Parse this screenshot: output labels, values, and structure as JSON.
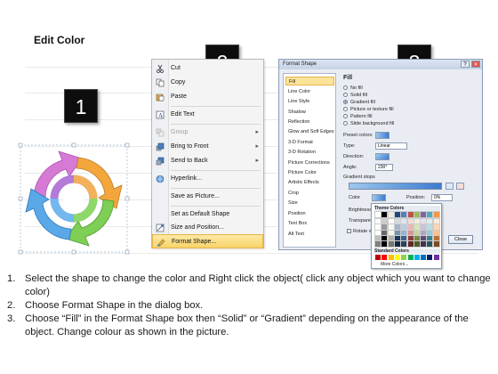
{
  "page": {
    "title": "Edit Color"
  },
  "badges": [
    "1",
    "2",
    "3"
  ],
  "context_menu": {
    "items": [
      {
        "label": "Cut",
        "icon": "scissors-icon"
      },
      {
        "label": "Copy",
        "icon": "copy-icon"
      },
      {
        "label": "Paste",
        "icon": "paste-icon"
      },
      {
        "label": "Edit Text",
        "icon": "edit-text-icon"
      },
      {
        "label": "Group",
        "icon": "group-icon",
        "disabled": true,
        "submenu": true
      },
      {
        "label": "Bring to Front",
        "icon": "bring-front-icon",
        "submenu": true
      },
      {
        "label": "Send to Back",
        "icon": "send-back-icon",
        "submenu": true
      },
      {
        "label": "Hyperlink...",
        "icon": "hyperlink-icon"
      },
      {
        "label": "Save as Picture...",
        "icon": "none"
      },
      {
        "label": "Set as Default Shape",
        "icon": "none"
      },
      {
        "label": "Size and Position...",
        "icon": "size-position-icon"
      },
      {
        "label": "Format Shape...",
        "icon": "format-shape-icon",
        "highlighted": true
      }
    ]
  },
  "dialog": {
    "title": "Format Shape",
    "nav": [
      "Fill",
      "Line Color",
      "Line Style",
      "Shadow",
      "Reflection",
      "Glow and Soft Edges",
      "3-D Format",
      "3-D Rotation",
      "Picture Corrections",
      "Picture Color",
      "Artistic Effects",
      "Crop",
      "Size",
      "Position",
      "Text Box",
      "Alt Text"
    ],
    "heading": "Fill",
    "fill_options": [
      "No fill",
      "Solid fill",
      "Gradient fill",
      "Picture or texture fill",
      "Pattern fill",
      "Slide background fill"
    ],
    "selected_fill": "Gradient fill",
    "preset_colors_label": "Preset colors:",
    "type_label": "Type:",
    "type_value": "Linear",
    "direction_label": "Direction:",
    "angle_label": "Angle:",
    "angle_value": "230°",
    "gradient_stops_label": "Gradient stops",
    "color_label": "Color",
    "position_label": "Position:",
    "position_value": "0%",
    "brightness_label": "Brightness",
    "transparency_label": "Transparen",
    "rotate_label": "Rotate wi",
    "theme_colors_label": "Theme Colors",
    "standard_colors_label": "Standard Colors",
    "more_colors_label": "More Colors...",
    "close_label": "Close",
    "theme_palette": [
      "#ffffff",
      "#000000",
      "#eeece1",
      "#1f497d",
      "#4f81bd",
      "#c0504d",
      "#9bbb59",
      "#8064a2",
      "#4bacc6",
      "#f79646"
    ],
    "standard_palette": [
      "#c00000",
      "#ff0000",
      "#ffc000",
      "#ffff00",
      "#92d050",
      "#00b050",
      "#00b0f0",
      "#0070c0",
      "#002060",
      "#7030a0"
    ]
  },
  "instructions": [
    {
      "num": "1.",
      "text": "Select the shape to change the color and Right click the object( click any object which you want to change color)"
    },
    {
      "num": "2.",
      "text": "Choose Format Shape in the dialog box."
    },
    {
      "num": "3.",
      "text": "Choose “Fill” in the Format Shape box then “Solid” or “Gradient” depending on the appearance of the object. Change colour as shown in the picture."
    }
  ]
}
